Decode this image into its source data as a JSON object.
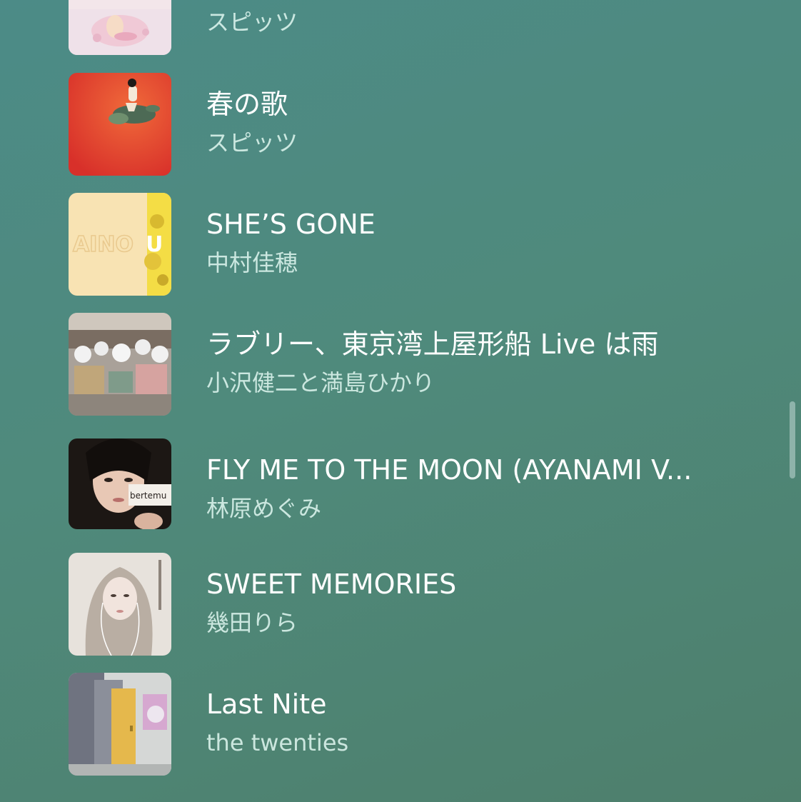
{
  "tracks": [
    {
      "title": "",
      "artist": "スピッツ",
      "artwork_icon": "album-art-pink-icon"
    },
    {
      "title": "春の歌",
      "artist": "スピッツ",
      "artwork_icon": "album-art-red-turtle-icon"
    },
    {
      "title": "SHE’S GONE",
      "artist": "中村佳穂",
      "artwork_icon": "album-art-ainou-icon",
      "artwork_text": "AINOU"
    },
    {
      "title": "ラブリー、東京湾上屋形船 Live は雨",
      "artist": "小沢健二と満島ひかり",
      "artwork_icon": "album-art-photo-icon"
    },
    {
      "title": "FLY ME TO THE MOON (AYANAMI V...",
      "artist": "林原めぐみ",
      "artwork_icon": "album-art-portrait-icon",
      "artwork_text": "bertemu"
    },
    {
      "title": "SWEET MEMORIES",
      "artist": "幾田りら",
      "artwork_icon": "album-art-illustration-icon"
    },
    {
      "title": "Last Nite",
      "artist": "the twenties",
      "artwork_icon": "album-art-door-icon"
    }
  ],
  "colors": {
    "background_top": "#4c8b87",
    "background_bottom": "#4e7f6c",
    "title": "#ffffff",
    "artist": "#dff7f0"
  }
}
